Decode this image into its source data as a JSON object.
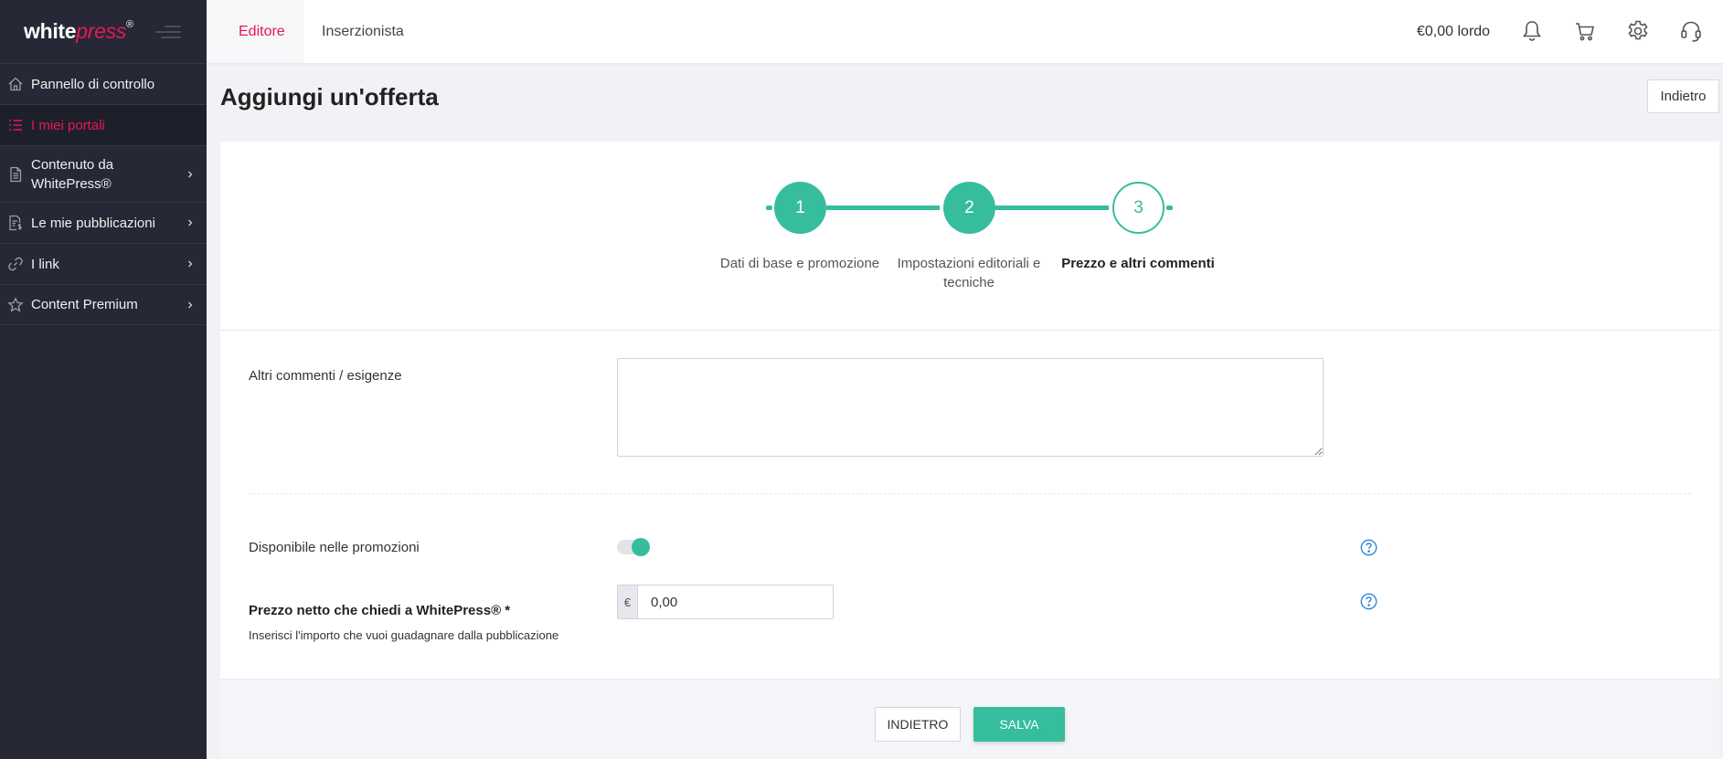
{
  "brand": {
    "name_white": "white",
    "name_press": "press",
    "registered": "®",
    "accent": "#e5185a",
    "primary": "#36bd9d"
  },
  "sidebar": {
    "items": [
      {
        "label": "Pannello di controllo",
        "icon": "home-icon",
        "active": false,
        "has_children": false
      },
      {
        "label": "I miei portali",
        "icon": "list-icon",
        "active": true,
        "has_children": false
      },
      {
        "label": "Contenuto da WhitePress®",
        "icon": "document-icon",
        "active": false,
        "has_children": true
      },
      {
        "label": "Le mie pubblicazioni",
        "icon": "invoice-icon",
        "active": false,
        "has_children": true
      },
      {
        "label": "I link",
        "icon": "link-icon",
        "active": false,
        "has_children": true
      },
      {
        "label": "Content Premium",
        "icon": "star-icon",
        "active": false,
        "has_children": true
      }
    ]
  },
  "topbar": {
    "tabs": [
      {
        "label": "Editore",
        "active": true
      },
      {
        "label": "Inserzionista",
        "active": false
      }
    ],
    "balance": "€0,00 lordo",
    "icons": [
      "bell-icon",
      "cart-icon",
      "gear-icon",
      "headset-icon"
    ]
  },
  "page": {
    "title": "Aggiungi un'offerta",
    "back_button": "Indietro"
  },
  "stepper": {
    "steps": [
      {
        "number": "1",
        "label": "Dati di base e promozione",
        "state": "done"
      },
      {
        "number": "2",
        "label": "Impostazioni editoriali e tecniche",
        "state": "done"
      },
      {
        "number": "3",
        "label": "Prezzo e altri commenti",
        "state": "current"
      }
    ]
  },
  "form": {
    "comments": {
      "label": "Altri commenti / esigenze",
      "value": ""
    },
    "promotions": {
      "label": "Disponibile nelle promozioni",
      "enabled": true
    },
    "price": {
      "label": "Prezzo netto che chiedi a WhitePress® *",
      "hint": "Inserisci l'importo che vuoi guadagnare dalla pubblicazione",
      "currency": "€",
      "value": "0,00"
    }
  },
  "footer": {
    "back_label": "INDIETRO",
    "save_label": "SALVA"
  }
}
